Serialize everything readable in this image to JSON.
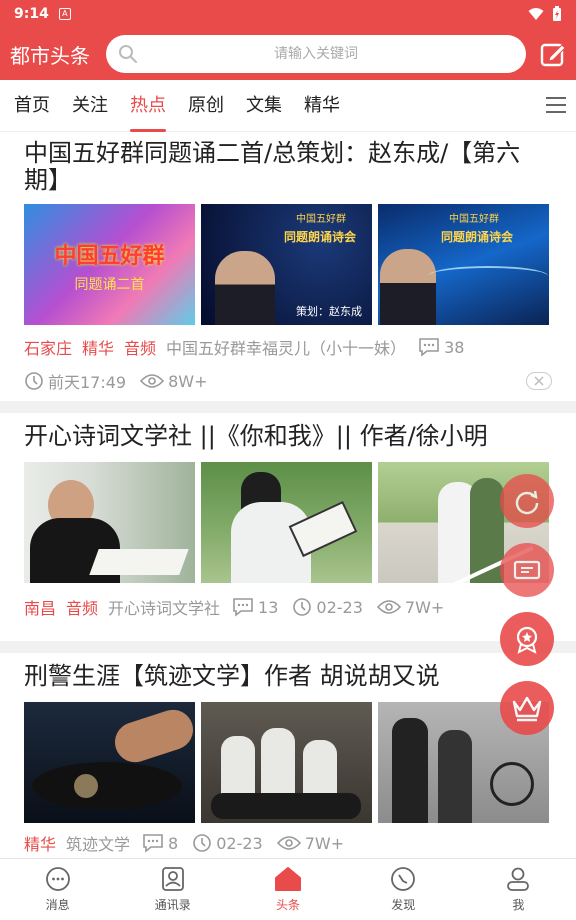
{
  "status_bar": {
    "time": "9:14",
    "app_badge": "A"
  },
  "header": {
    "brand": "都市头条",
    "search_placeholder": "请输入关键词"
  },
  "tabs": [
    {
      "label": "首页"
    },
    {
      "label": "关注"
    },
    {
      "label": "热点",
      "active": true
    },
    {
      "label": "原创"
    },
    {
      "label": "文集"
    },
    {
      "label": "精华"
    }
  ],
  "articles": [
    {
      "title": "中国五好群同题诵二首/总策划：赵东成/【第六期】",
      "image_captions": [
        "中国五好群",
        "同题诵二首",
        "中国五好群",
        "同题朗诵诗会",
        "策划：赵东成",
        "中国五好群",
        "同题朗诵诗会"
      ],
      "tags": [
        "石家庄",
        "精华",
        "音频"
      ],
      "source": "中国五好群幸福灵儿（小十一妹）",
      "comments": "38",
      "time": "前天17:49",
      "views": "8W+"
    },
    {
      "title": "开心诗词文学社 ||《你和我》|| 作者/徐小明",
      "tags": [
        "南昌",
        "音频"
      ],
      "source": "开心诗词文学社",
      "comments": "13",
      "date": "02-23",
      "views": "7W+"
    },
    {
      "title": "刑警生涯【筑迹文学】作者 胡说胡又说",
      "tags": [
        "精华"
      ],
      "source": "筑迹文学",
      "comments": "8",
      "date": "02-23",
      "views": "7W+"
    }
  ],
  "bottom_nav": [
    {
      "label": "消息",
      "icon": "message-icon"
    },
    {
      "label": "通讯录",
      "icon": "contacts-icon"
    },
    {
      "label": "头条",
      "icon": "home-icon",
      "active": true
    },
    {
      "label": "发现",
      "icon": "compass-icon"
    },
    {
      "label": "我",
      "icon": "user-icon"
    }
  ],
  "colors": {
    "accent": "#e94b4b",
    "muted": "#999999"
  }
}
